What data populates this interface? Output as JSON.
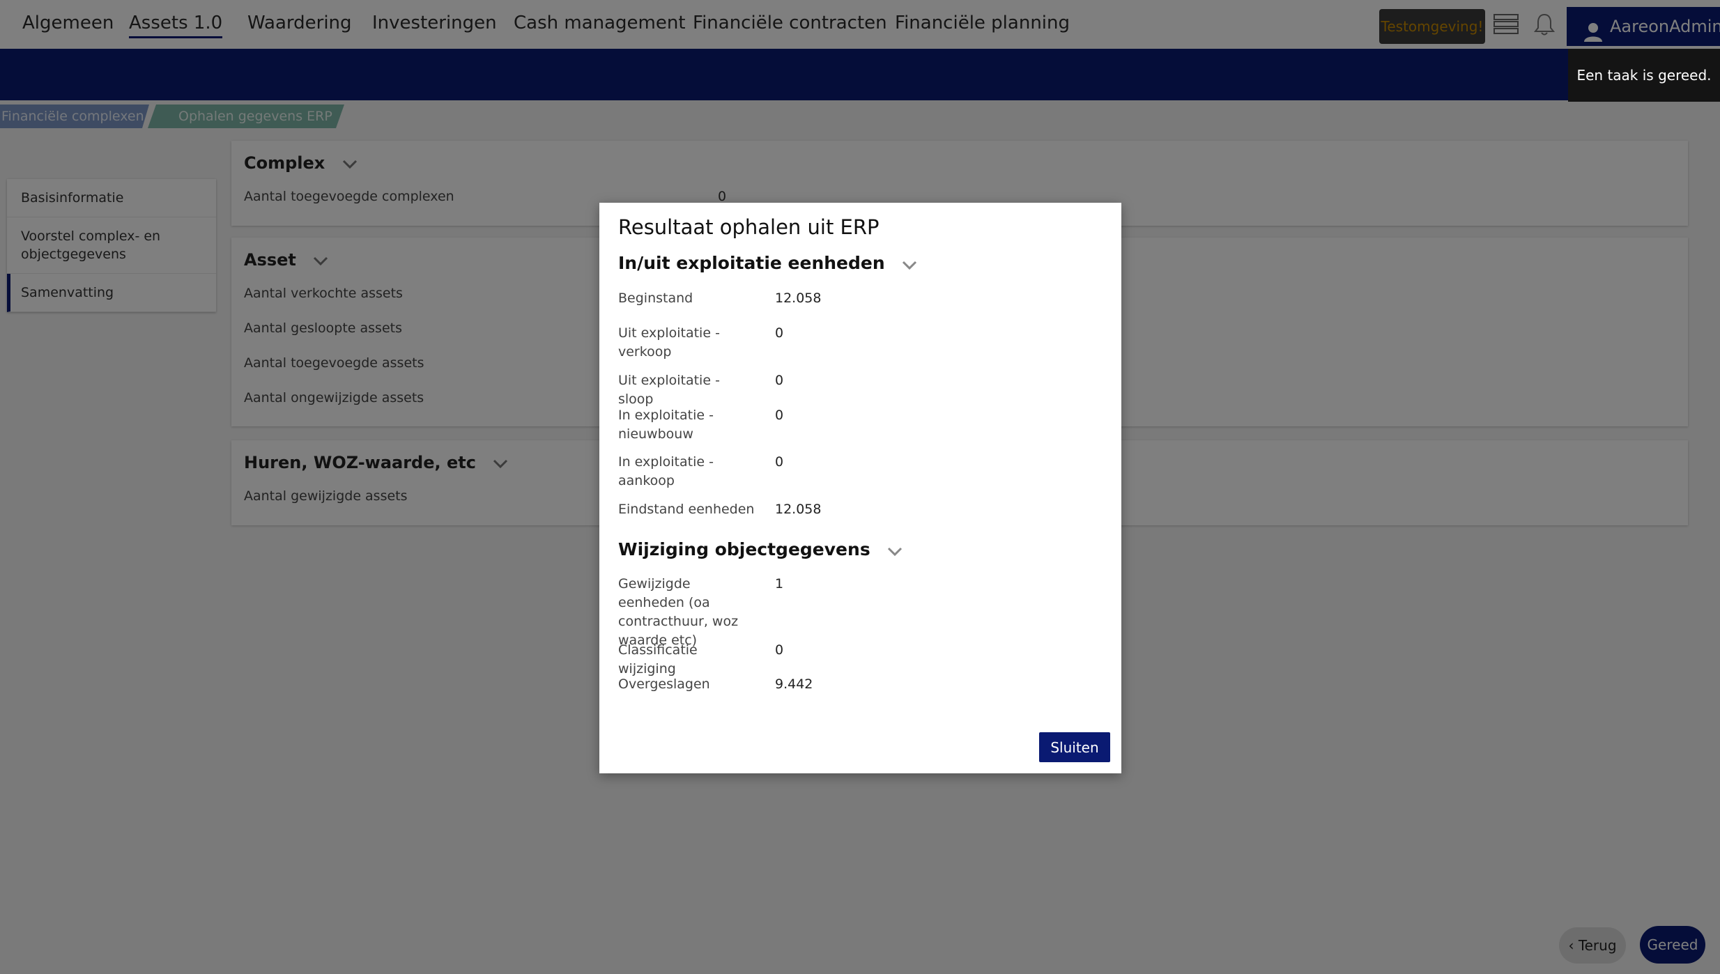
{
  "nav": {
    "items": [
      "Algemeen",
      "Assets 1.0",
      "Waardering",
      "Investeringen",
      "Cash management",
      "Financiële contracten",
      "Financiële planning"
    ],
    "active_index": 1,
    "test_badge": "Testomgeving!",
    "user": "AareonAdmin"
  },
  "toast": "Een taak is gereed.",
  "breadcrumb": {
    "item1": "Financiële complexen",
    "item2": "Ophalen gegevens ERP"
  },
  "steps": [
    "Basisinformatie",
    "Voorstel complex- en objectgegevens",
    "Samenvatting"
  ],
  "active_step": 2,
  "cards": {
    "complex": {
      "title": "Complex",
      "rows": [
        {
          "label": "Aantal toegevoegde complexen",
          "value": "0"
        }
      ]
    },
    "asset": {
      "title": "Asset",
      "rows": [
        {
          "label": "Aantal verkochte assets"
        },
        {
          "label": "Aantal gesloopte assets"
        },
        {
          "label": "Aantal toegevoegde assets"
        },
        {
          "label": "Aantal ongewijzigde assets"
        }
      ]
    },
    "huren": {
      "title": "Huren, WOZ-waarde, etc",
      "rows": [
        {
          "label": "Aantal gewijzigde assets"
        }
      ]
    }
  },
  "modal": {
    "title": "Resultaat ophalen uit ERP",
    "section1": {
      "title": "In/uit exploitatie eenheden",
      "rows": [
        {
          "label": "Beginstand",
          "value": "12.058"
        },
        {
          "label": "Uit exploitatie - verkoop",
          "value": "0"
        },
        {
          "label": "Uit exploitatie - sloop",
          "value": "0"
        },
        {
          "label": "In exploitatie - nieuwbouw",
          "value": "0"
        },
        {
          "label": "In exploitatie - aankoop",
          "value": "0"
        },
        {
          "label": "Eindstand eenheden",
          "value": "12.058"
        }
      ]
    },
    "section2": {
      "title": "Wijziging objectgegevens",
      "rows": [
        {
          "label": "Gewijzigde eenheden (oa contracthuur, woz waarde etc)",
          "value": "1"
        },
        {
          "label": "Classificatie wijziging",
          "value": "0"
        },
        {
          "label": "Overgeslagen",
          "value": "9.442"
        }
      ]
    },
    "close_label": "Sluiten"
  },
  "footer": {
    "back_label": "Terug",
    "done_label": "Gereed"
  },
  "colors": {
    "navy": "#0a1a72",
    "breadcrumb_blue": "#7c97c6",
    "breadcrumb_green": "#7fb6a8",
    "test_badge_text": "#c98a00"
  }
}
